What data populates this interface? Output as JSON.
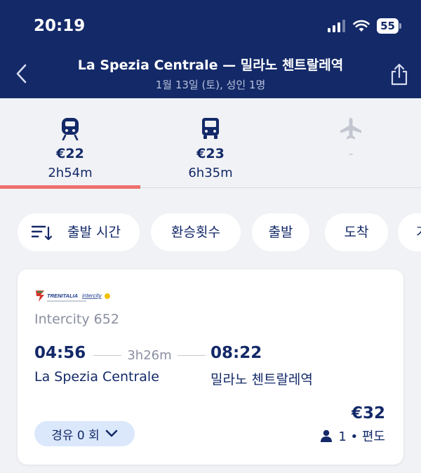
{
  "status_bar": {
    "time": "20:19",
    "battery": "55"
  },
  "header": {
    "title": "La Spezia Centrale — 밀라노 첸트랄레역",
    "subtitle": "1월 13일 (토), 성인 1명"
  },
  "modes": [
    {
      "name": "train",
      "price": "€22",
      "duration": "2h54m",
      "selected": true
    },
    {
      "name": "bus",
      "price": "€23",
      "duration": "6h35m",
      "selected": false
    },
    {
      "name": "plane",
      "price": "-",
      "duration": "",
      "selected": false
    }
  ],
  "filters": {
    "sort": "출발 시간",
    "transfers": "환승횟수",
    "departure": "출발",
    "arrival": "도착",
    "more": "가"
  },
  "result": {
    "operator": "TRENITALIA intercity",
    "train_name": "Intercity 652",
    "departure_time": "04:56",
    "duration": "3h26m",
    "arrival_time": "08:22",
    "departure_station": "La Spezia Centrale",
    "arrival_station": "밀라노 첸트랄레역",
    "price": "€32",
    "passengers": "1 • 편도",
    "stops": "경유 0 회"
  }
}
